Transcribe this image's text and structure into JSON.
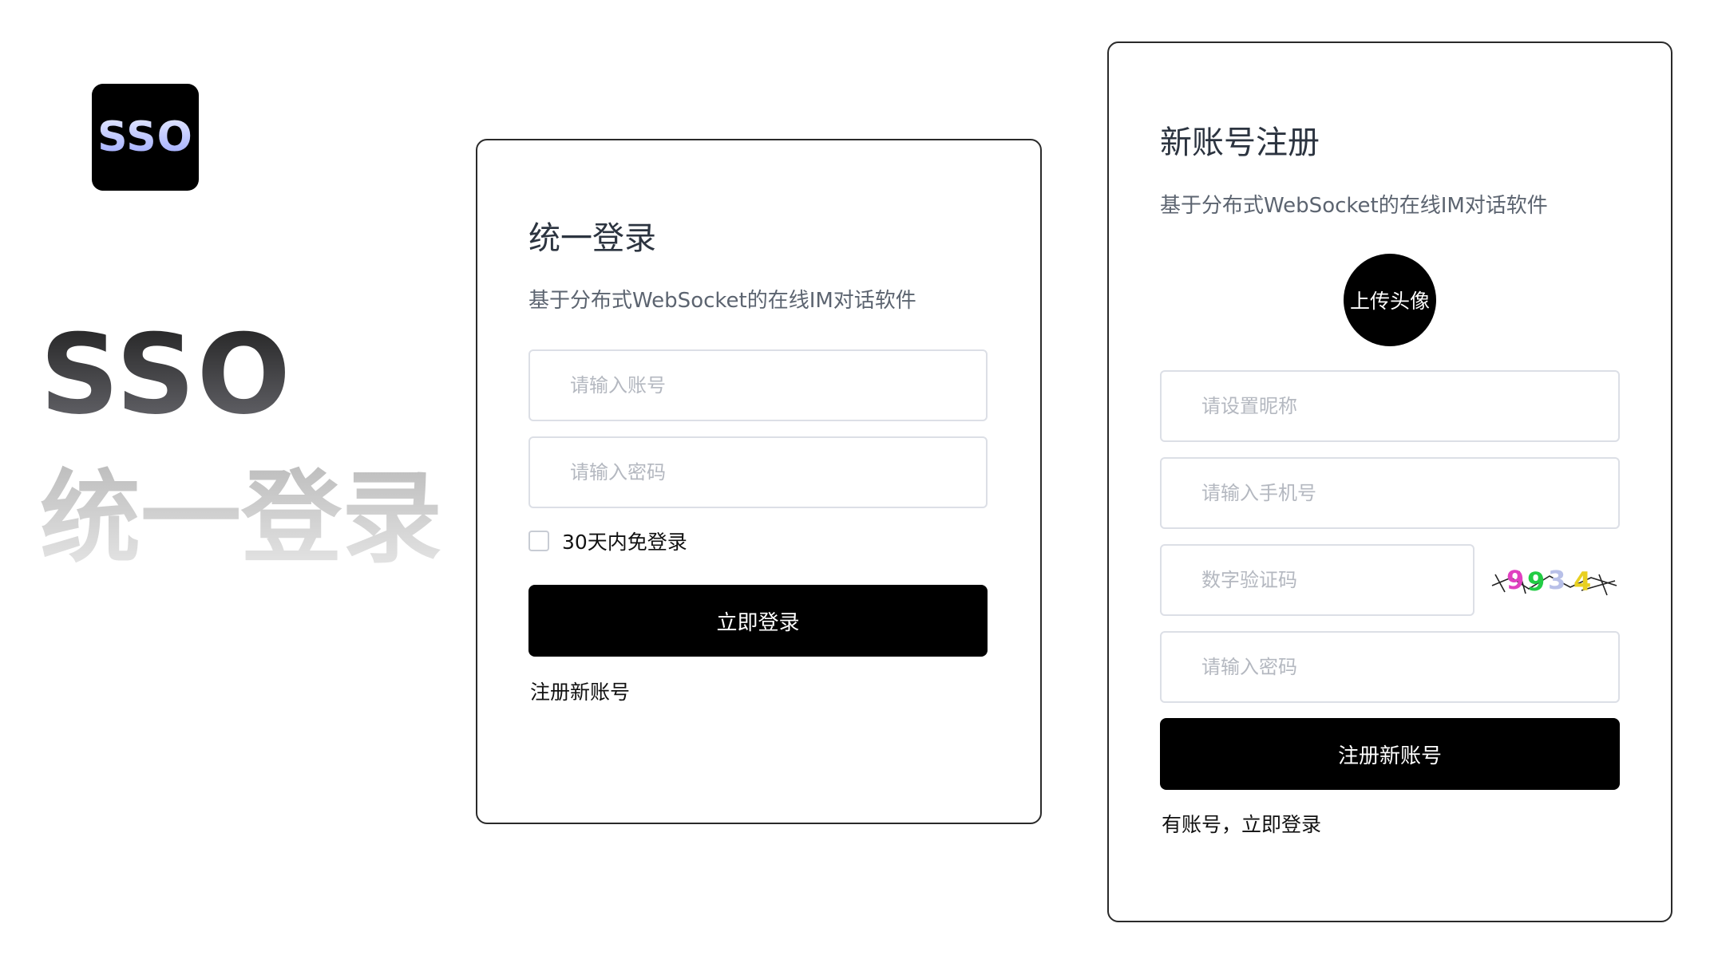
{
  "branding": {
    "logo_text": "SSO",
    "hero_title": "SSO",
    "hero_subtitle": "统一登录"
  },
  "login": {
    "title": "统一登录",
    "subtitle": "基于分布式WebSocket的在线IM对话软件",
    "account_placeholder": "请输入账号",
    "password_placeholder": "请输入密码",
    "remember_label": "30天内免登录",
    "remember_checked": false,
    "submit_label": "立即登录",
    "register_link": "注册新账号"
  },
  "register": {
    "title": "新账号注册",
    "subtitle": "基于分布式WebSocket的在线IM对话软件",
    "avatar_label": "上传头像",
    "nickname_placeholder": "请设置昵称",
    "phone_placeholder": "请输入手机号",
    "code_placeholder": "数字验证码",
    "captcha_digits": [
      "9",
      "9",
      "3",
      "4"
    ],
    "captcha_colors": [
      "#e040c0",
      "#22cc44",
      "#b8c0e8",
      "#e8d020"
    ],
    "password_placeholder": "请输入密码",
    "submit_label": "注册新账号",
    "login_link": "有账号，立即登录"
  },
  "colors": {
    "accent": "#000000",
    "card_border": "#2a2a2a",
    "input_border": "#dcdfe6",
    "placeholder": "#b4b8c0"
  }
}
